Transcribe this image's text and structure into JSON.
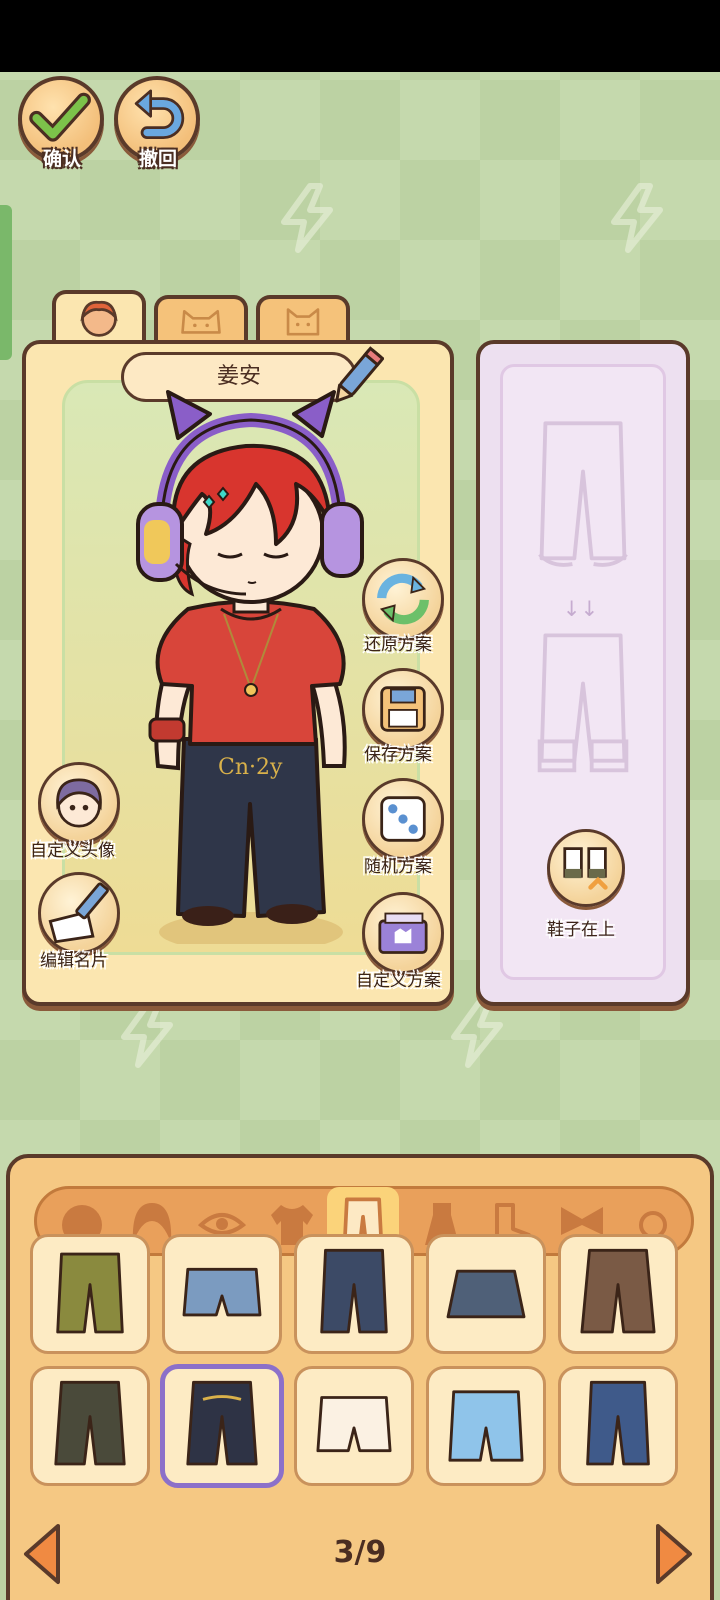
{
  "top_buttons": {
    "confirm_label": "确认",
    "undo_label": "撤回"
  },
  "tabs": [
    {
      "name": "character",
      "icon": "face-icon"
    },
    {
      "name": "cat-1",
      "icon": "cat-icon"
    },
    {
      "name": "cat-2",
      "icon": "cat-icon"
    }
  ],
  "character": {
    "name": "姜安",
    "shirt_text": "Cn·2y"
  },
  "actions": {
    "restore": "还原方案",
    "save": "保存方案",
    "random": "随机方案",
    "custom": "自定义方案",
    "custom_avatar": "自定义头像",
    "edit_card": "编辑名片"
  },
  "preview": {
    "shoes_on_top": "鞋子在上"
  },
  "categories": [
    "face",
    "hair",
    "eyes",
    "top",
    "bottom",
    "dress",
    "shoes",
    "accessory",
    "more"
  ],
  "active_category": "bottom",
  "items": [
    {
      "name": "olive-cargo-pants",
      "color": "#8a8a3e"
    },
    {
      "name": "denim-shorts",
      "color": "#7b9bc0"
    },
    {
      "name": "dark-jeans",
      "color": "#3c4a66"
    },
    {
      "name": "ripped-denim-skirt",
      "color": "#4f6078"
    },
    {
      "name": "brown-wide-pants",
      "color": "#7a5a45"
    },
    {
      "name": "camo-pants",
      "color": "#4a4a3a"
    },
    {
      "name": "black-graphic-pants",
      "color": "#2e3345"
    },
    {
      "name": "white-shorts",
      "color": "#fbf1e3"
    },
    {
      "name": "star-shorts",
      "color": "#8fc4ea"
    },
    {
      "name": "bow-jeans",
      "color": "#3f5a8a"
    }
  ],
  "selected_item": 6,
  "pagination": {
    "label": "3/9"
  }
}
